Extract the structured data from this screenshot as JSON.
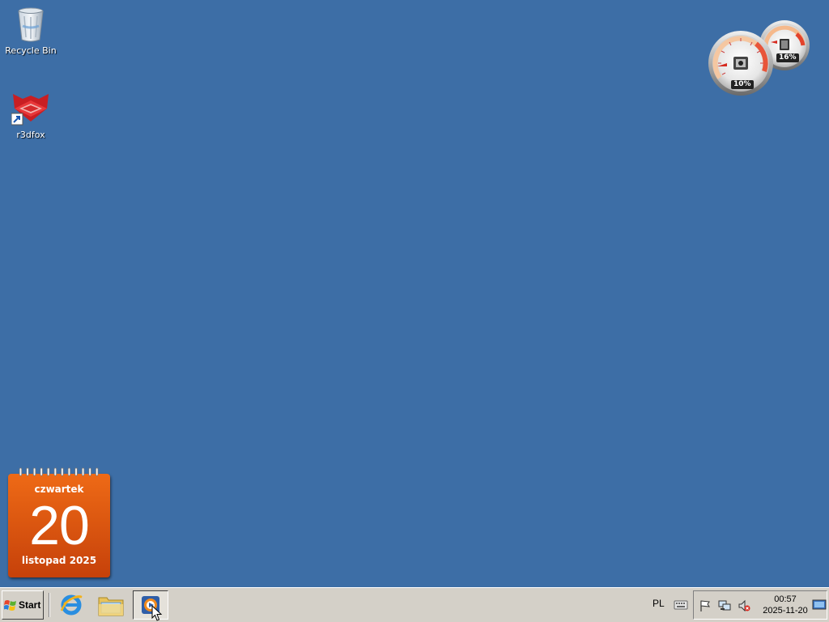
{
  "desktop": {
    "icons": [
      {
        "label": "Recycle Bin",
        "icon": "recycle-bin-icon"
      },
      {
        "label": "r3dfox",
        "icon": "r3dfox-icon"
      }
    ]
  },
  "gadgets": {
    "cpu_meter": {
      "cpu_label": "10%",
      "cpu_value": 10,
      "memory_label": "16%",
      "memory_value": 16
    },
    "calendar": {
      "weekday": "czwartek",
      "day": "20",
      "month_year": "listopad 2025"
    }
  },
  "taskbar": {
    "start_label": "Start",
    "quick_launch": [
      {
        "icon": "internet-explorer-icon"
      },
      {
        "icon": "windows-explorer-icon"
      },
      {
        "icon": "media-player-icon",
        "active": true
      }
    ],
    "language": "PL",
    "tray": {
      "icons": [
        "keyboard-icon",
        "action-center-flag-icon",
        "network-icon",
        "volume-muted-icon"
      ],
      "time": "00:57",
      "date": "2025-11-20"
    }
  },
  "colors": {
    "desktop_bg": "#3d6ea6",
    "taskbar_bg": "#d4d0c8",
    "calendar_orange": "#e05a10"
  }
}
